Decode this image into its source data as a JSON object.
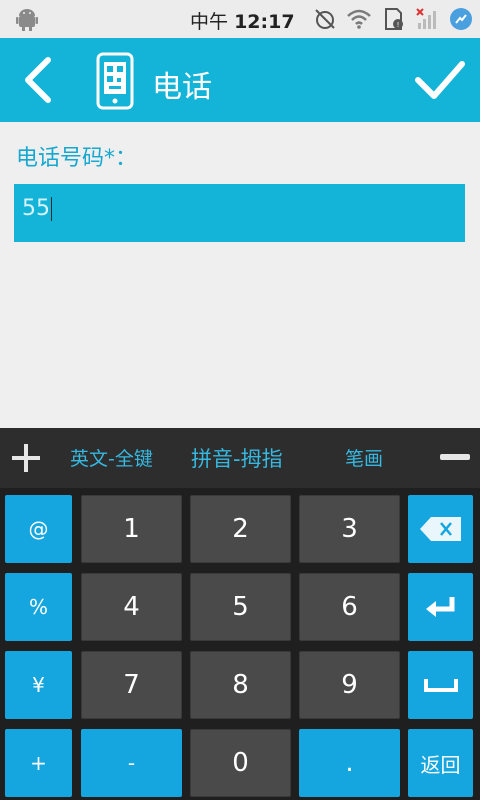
{
  "status_bar": {
    "time_prefix": "中午",
    "time": "12:17",
    "icons": [
      "android-debug-icon",
      "alarm-off-icon",
      "wifi-icon",
      "sd-card-icon",
      "signal-off-icon",
      "messenger-icon"
    ]
  },
  "header": {
    "title": "电话",
    "accent_color": "#13b4d8"
  },
  "form": {
    "field_label": "电话号码*：",
    "field_value": "55"
  },
  "keyboard": {
    "mode_options": [
      "英文-全键",
      "拼音-拇指",
      "笔画"
    ],
    "rows": [
      [
        "@",
        "1",
        "2",
        "3",
        "⌫"
      ],
      [
        "%",
        "4",
        "5",
        "6",
        "↵"
      ],
      [
        "¥",
        "7",
        "8",
        "9",
        "␣"
      ],
      [
        "+",
        "-",
        "0",
        ".",
        "返回"
      ]
    ],
    "backspace_icon": "backspace-icon",
    "enter_icon": "enter-icon",
    "space_icon": "space-icon",
    "return_label": "返回"
  }
}
